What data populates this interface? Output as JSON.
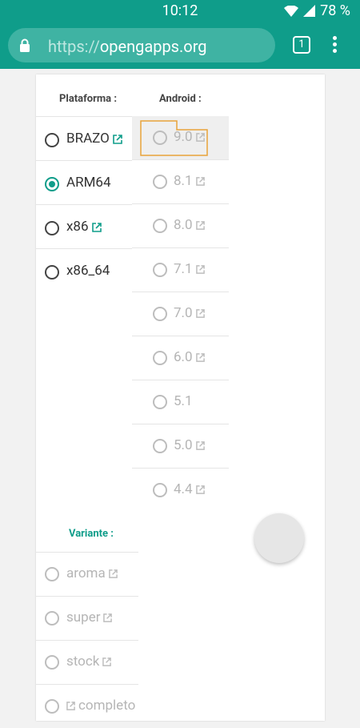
{
  "status": {
    "time": "10:12",
    "battery": "78 %"
  },
  "browser": {
    "url_scheme": "https://",
    "url_host": "opengapps.org",
    "tab_count": "1"
  },
  "headers": {
    "platform": "Plataforma :",
    "android": "Android :",
    "variant": "Variante :"
  },
  "platforms": [
    {
      "label": "BRAZO",
      "state": "unchecked",
      "external": true
    },
    {
      "label": "ARM64",
      "state": "checked",
      "external": false
    },
    {
      "label": "x86",
      "state": "unchecked",
      "external": true
    },
    {
      "label": "x86_64",
      "state": "unchecked",
      "external": false
    }
  ],
  "android_versions": [
    {
      "label": "9.0",
      "external": true,
      "highlighted": true
    },
    {
      "label": "8.1",
      "external": true
    },
    {
      "label": "8.0",
      "external": true
    },
    {
      "label": "7.1",
      "external": true
    },
    {
      "label": "7.0",
      "external": true
    },
    {
      "label": "6.0",
      "external": true
    },
    {
      "label": "5.1",
      "external": false
    },
    {
      "label": "5.0",
      "external": true
    },
    {
      "label": "4.4",
      "external": true
    }
  ],
  "variants": [
    {
      "label": "aroma",
      "external": true
    },
    {
      "label": "super",
      "external": true
    },
    {
      "label": "stock",
      "external": true
    },
    {
      "label": "completo",
      "external": true,
      "icon_before": true
    }
  ],
  "colors": {
    "accent": "#0f9d8a",
    "disabled": "#b5b5b5"
  }
}
